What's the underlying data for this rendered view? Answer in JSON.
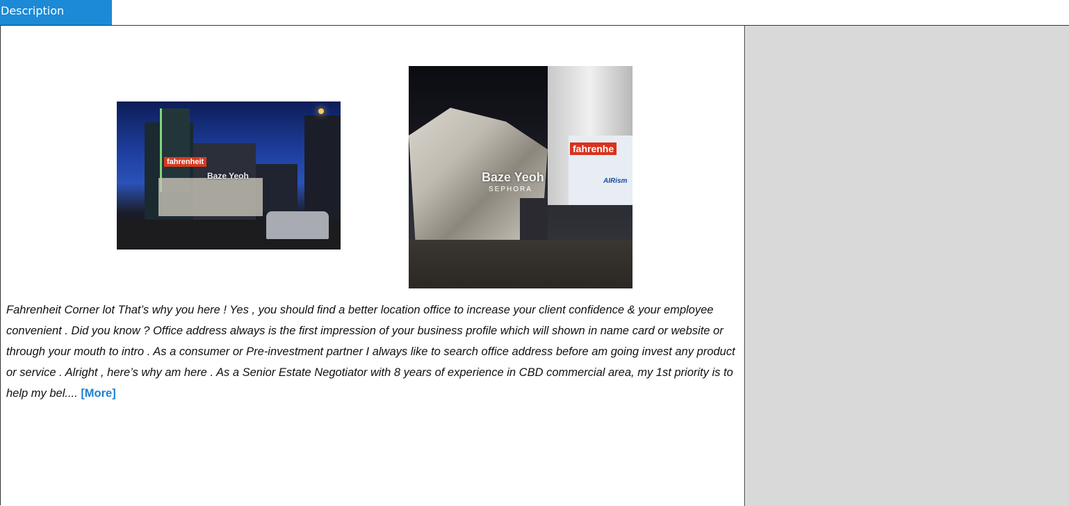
{
  "tab": {
    "label": "Description"
  },
  "photos": [
    {
      "watermark": "Baze Yeoh",
      "sign": "fahrenheit"
    },
    {
      "watermark": "Baze Yeoh",
      "sub": "SEPHORA",
      "sign": "fahrenhe",
      "billboard": "AIRism"
    }
  ],
  "description": {
    "text": "Fahrenheit Corner lot That’s why you here ! Yes , you should find a better location office to increase your client confidence & your employee convenient .  Did you know ? Office address always is the first impression of your business profile which will shown in name card or website or through your mouth to intro .  As a consumer or Pre-investment partner I always like to search office address before am going invest any product or service .  Alright , here’s why am here .  As a Senior Estate Negotiator with 8 years of experience in CBD commercial area, my 1st priority is to help my bel.... ",
    "more_label": "[More]"
  }
}
